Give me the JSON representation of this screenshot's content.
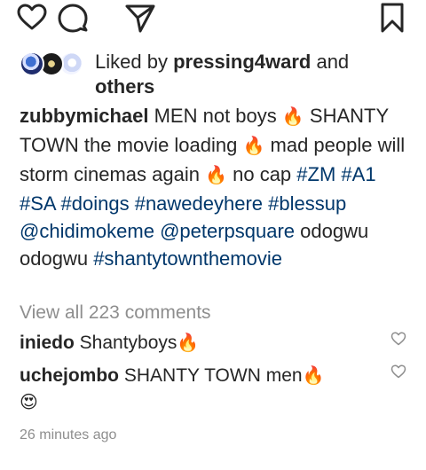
{
  "actions": {
    "like_icon": "heart-outline-icon",
    "comment_icon": "comment-bubble-icon",
    "share_icon": "paper-plane-icon",
    "save_icon": "bookmark-icon"
  },
  "likes": {
    "prefix": "Liked by ",
    "user": "pressing4ward",
    "conjunction": " and ",
    "others": "others"
  },
  "caption": {
    "username": "zubbymichael",
    "seg1": " MEN not boys ",
    "flame1": "🔥",
    "seg2": " SHANTY TOWN the movie loading ",
    "flame2": "🔥",
    "seg3": " mad people will storm cinemas again ",
    "flame3": "🔥",
    "seg4": " no cap ",
    "tag1": "#ZM",
    "tag2": "#A1",
    "tag3": "#SA",
    "tag4": "#doings",
    "tag5": "#nawedeyhere",
    "tag6": "#blessup",
    "mention1": "@chidimokeme",
    "mention2": "@peterpsquare",
    "seg5": " odogwu odogwu ",
    "tag7": "#shantytownthemovie"
  },
  "view_comments": "View all 223 comments",
  "comments": [
    {
      "username": "iniedo",
      "text": " Shantyboys",
      "emoji": "🔥"
    },
    {
      "username": "uchejombo",
      "text": " SHANTY TOWN men",
      "emoji": "🔥",
      "emoji2": "😍"
    }
  ],
  "timestamp": "26 minutes ago",
  "colors": {
    "text": "#262626",
    "link": "#00376b",
    "muted": "#8e8e8e",
    "background": "#ffffff"
  }
}
